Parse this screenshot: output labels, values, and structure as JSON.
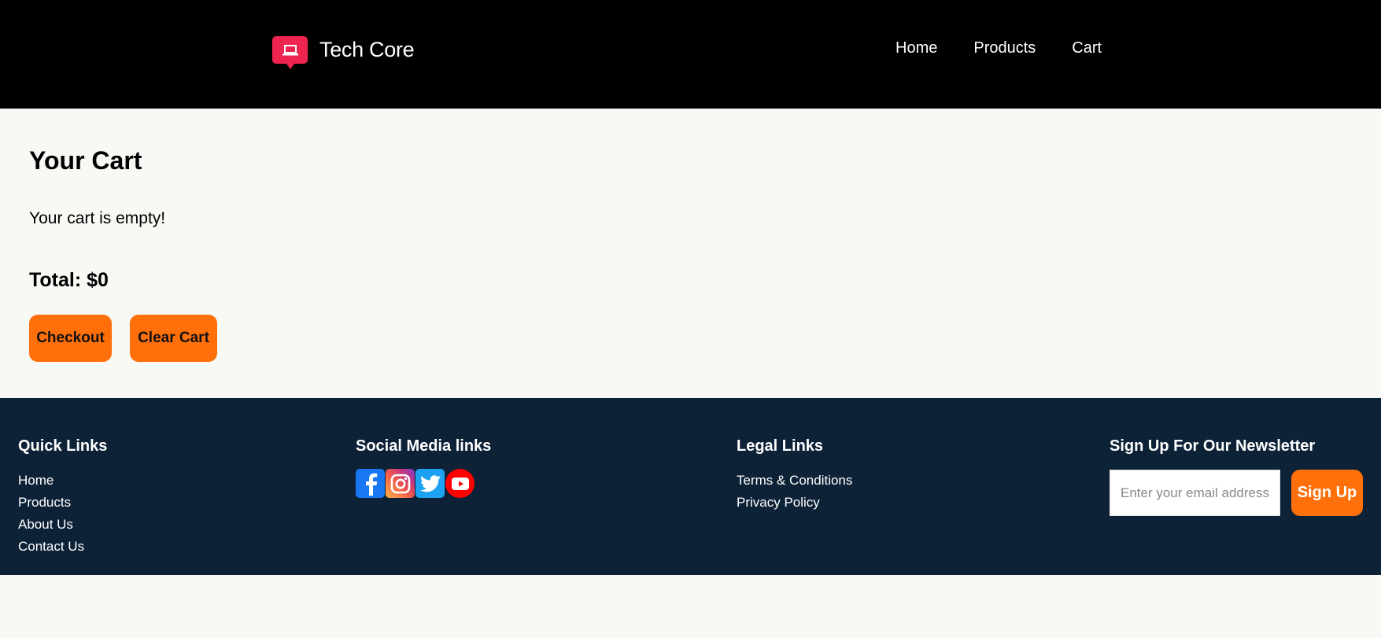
{
  "header": {
    "brand": "Tech Core",
    "brand_icon": "laptop-icon",
    "brand_color": "#f0254f",
    "nav": [
      {
        "label": "Home"
      },
      {
        "label": "Products"
      },
      {
        "label": "Cart"
      }
    ]
  },
  "cart": {
    "title": "Your Cart",
    "empty_message": "Your cart is empty!",
    "total_label": "Total: $0",
    "checkout_label": "Checkout",
    "clear_label": "Clear Cart",
    "accent_color": "#ff6f0a"
  },
  "footer": {
    "quick_links": {
      "heading": "Quick Links",
      "items": [
        "Home",
        "Products",
        "About Us",
        "Contact Us"
      ]
    },
    "social": {
      "heading": "Social Media links",
      "icons": [
        "facebook-icon",
        "instagram-icon",
        "twitter-icon",
        "youtube-icon"
      ]
    },
    "legal": {
      "heading": "Legal Links",
      "items": [
        "Terms & Conditions",
        "Privacy Policy"
      ]
    },
    "newsletter": {
      "heading": "Sign Up For Our Newsletter",
      "placeholder": "Enter your email address here",
      "button_label": "Sign Up"
    },
    "background": "#0e2237"
  }
}
